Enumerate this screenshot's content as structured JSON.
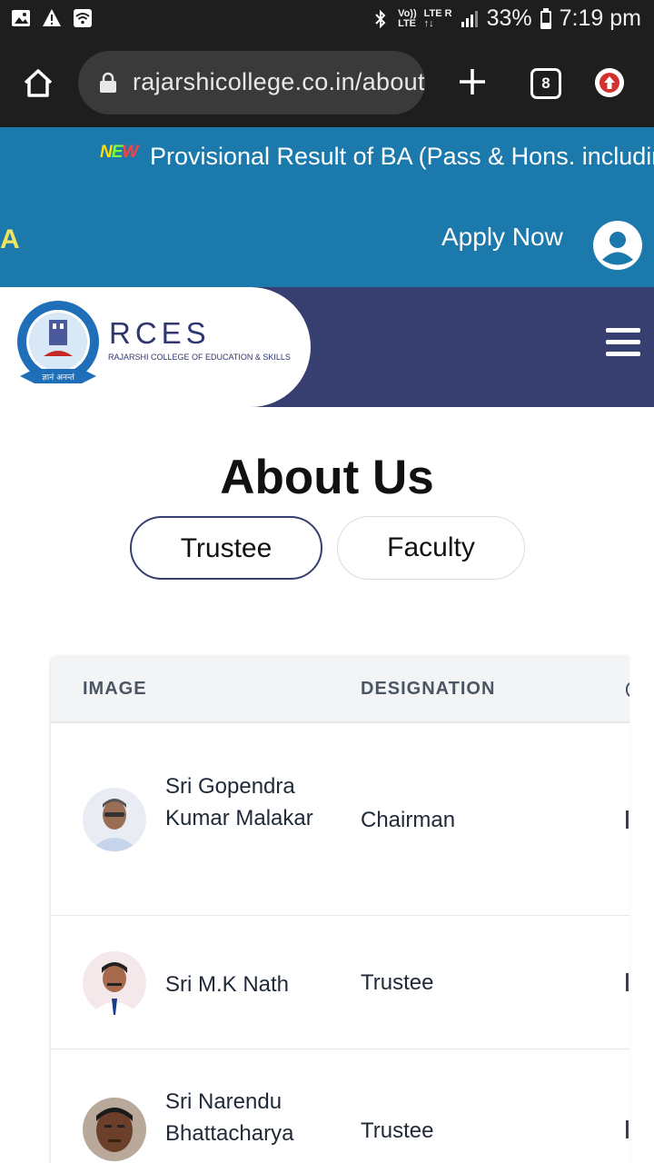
{
  "status_bar": {
    "network_top": "Vo))",
    "network_bottom": "LTE",
    "lte_top": "LTE R",
    "battery": "33%",
    "time": "7:19 pm"
  },
  "browser": {
    "url": "rajarshicollege.co.in/about",
    "tab_count": "8"
  },
  "announcement": {
    "badge": "NEW",
    "text": "Provisional Result of BA (Pass & Hons. including",
    "cut_letter": "A"
  },
  "topbar": {
    "apply_label": "Apply Now"
  },
  "brand": {
    "name": "RCES",
    "tagline": "RAJARSHI COLLEGE OF EDUCATION & SKILLS",
    "colors": {
      "primary": "#373e70",
      "accent": "#1b79ab"
    }
  },
  "page": {
    "title": "About Us",
    "tabs": [
      {
        "label": "Trustee",
        "active": true
      },
      {
        "label": "Faculty",
        "active": false
      }
    ]
  },
  "table": {
    "headers": [
      "IMAGE",
      "DESIGNATION"
    ],
    "rows": [
      {
        "name": "Sri Gopendra Kumar Malakar",
        "designation": "Chairman"
      },
      {
        "name": "Sri M.K Nath",
        "designation": "Trustee"
      },
      {
        "name": "Sri Narendu Bhattacharya",
        "designation": "Trustee"
      }
    ]
  }
}
